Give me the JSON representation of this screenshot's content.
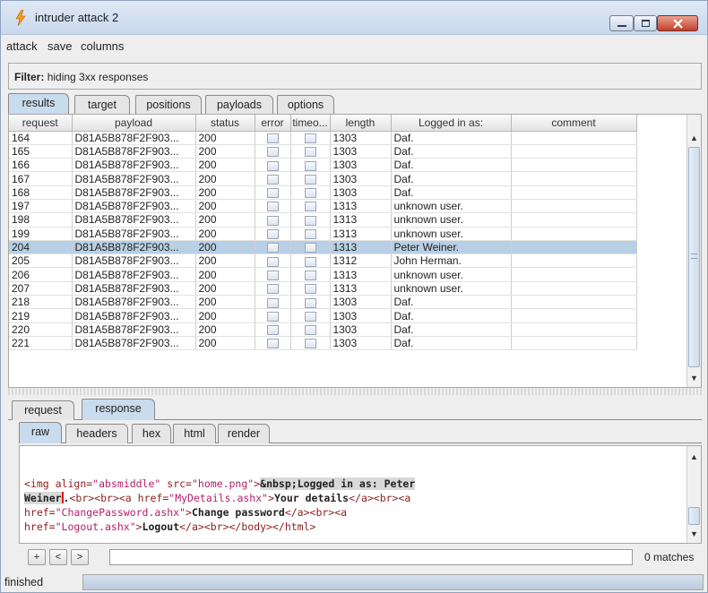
{
  "window": {
    "title": "intruder attack 2"
  },
  "menu": [
    "attack",
    "save",
    "columns"
  ],
  "filter": {
    "label": "Filter:",
    "text": "hiding 3xx responses"
  },
  "main_tabs": [
    "results",
    "target",
    "positions",
    "payloads",
    "options"
  ],
  "results": {
    "columns": [
      "request",
      "payload",
      "status",
      "error",
      "timeo...",
      "length",
      "Logged in as:",
      "comment"
    ],
    "rows": [
      {
        "request": "164",
        "payload": "D81A5B878F2F903...",
        "status": "200",
        "length": "1303",
        "user": "Daf.",
        "comment": ""
      },
      {
        "request": "165",
        "payload": "D81A5B878F2F903...",
        "status": "200",
        "length": "1303",
        "user": "Daf.",
        "comment": ""
      },
      {
        "request": "166",
        "payload": "D81A5B878F2F903...",
        "status": "200",
        "length": "1303",
        "user": "Daf.",
        "comment": ""
      },
      {
        "request": "167",
        "payload": "D81A5B878F2F903...",
        "status": "200",
        "length": "1303",
        "user": "Daf.",
        "comment": ""
      },
      {
        "request": "168",
        "payload": "D81A5B878F2F903...",
        "status": "200",
        "length": "1303",
        "user": "Daf.",
        "comment": ""
      },
      {
        "request": "197",
        "payload": "D81A5B878F2F903...",
        "status": "200",
        "length": "1313",
        "user": "unknown user.",
        "comment": ""
      },
      {
        "request": "198",
        "payload": "D81A5B878F2F903...",
        "status": "200",
        "length": "1313",
        "user": "unknown user.",
        "comment": ""
      },
      {
        "request": "199",
        "payload": "D81A5B878F2F903...",
        "status": "200",
        "length": "1313",
        "user": "unknown user.",
        "comment": ""
      },
      {
        "request": "204",
        "payload": "D81A5B878F2F903...",
        "status": "200",
        "length": "1313",
        "user": "Peter Weiner.",
        "comment": ""
      },
      {
        "request": "205",
        "payload": "D81A5B878F2F903...",
        "status": "200",
        "length": "1312",
        "user": "John Herman.",
        "comment": ""
      },
      {
        "request": "206",
        "payload": "D81A5B878F2F903...",
        "status": "200",
        "length": "1313",
        "user": "unknown user.",
        "comment": ""
      },
      {
        "request": "207",
        "payload": "D81A5B878F2F903...",
        "status": "200",
        "length": "1313",
        "user": "unknown user.",
        "comment": ""
      },
      {
        "request": "218",
        "payload": "D81A5B878F2F903...",
        "status": "200",
        "length": "1303",
        "user": "Daf.",
        "comment": ""
      },
      {
        "request": "219",
        "payload": "D81A5B878F2F903...",
        "status": "200",
        "length": "1303",
        "user": "Daf.",
        "comment": ""
      },
      {
        "request": "220",
        "payload": "D81A5B878F2F903...",
        "status": "200",
        "length": "1303",
        "user": "Daf.",
        "comment": ""
      },
      {
        "request": "221",
        "payload": "D81A5B878F2F903...",
        "status": "200",
        "length": "1303",
        "user": "Daf.",
        "comment": ""
      }
    ],
    "selected_request": "204"
  },
  "detail_tabs": [
    "request",
    "response"
  ],
  "view_tabs": [
    "raw",
    "headers",
    "hex",
    "html",
    "render"
  ],
  "response_lines": [
    [
      [
        "tag",
        "<img "
      ],
      [
        "att",
        "align="
      ],
      [
        "str",
        "\"absmiddle\""
      ],
      [
        "att",
        " src="
      ],
      [
        "str",
        "\"home.png\""
      ],
      [
        "tag",
        ">"
      ],
      [
        "bold",
        "&nbsp;Logged in as: Peter"
      ]
    ],
    [
      [
        "bold",
        "Weiner"
      ],
      [
        "caret",
        ""
      ],
      [
        "bold",
        "."
      ],
      [
        "tag",
        "<br><br><a "
      ],
      [
        "att",
        "href="
      ],
      [
        "str",
        "\"MyDetails.ashx\""
      ],
      [
        "tag",
        ">"
      ],
      [
        "bold",
        "Your details"
      ],
      [
        "tag",
        "</a><br><a"
      ]
    ],
    [
      [
        "att",
        "href="
      ],
      [
        "str",
        "\"ChangePassword.ashx\""
      ],
      [
        "tag",
        ">"
      ],
      [
        "bold",
        "Change password"
      ],
      [
        "tag",
        "</a><br><a"
      ]
    ],
    [
      [
        "att",
        "href="
      ],
      [
        "str",
        "\"Logout.ashx\""
      ],
      [
        "tag",
        ">"
      ],
      [
        "bold",
        "Logout"
      ],
      [
        "tag",
        "</a><br></body></html>"
      ]
    ]
  ],
  "search": {
    "buttons": [
      "+",
      "<",
      ">"
    ],
    "value": "",
    "matches": "0 matches"
  },
  "status": {
    "text": "finished"
  },
  "colors": {
    "selected_row": "#b8cfe5",
    "active_tab": "#c9dcee",
    "tag": "#8b1d1d",
    "string": "#b21f6b"
  }
}
